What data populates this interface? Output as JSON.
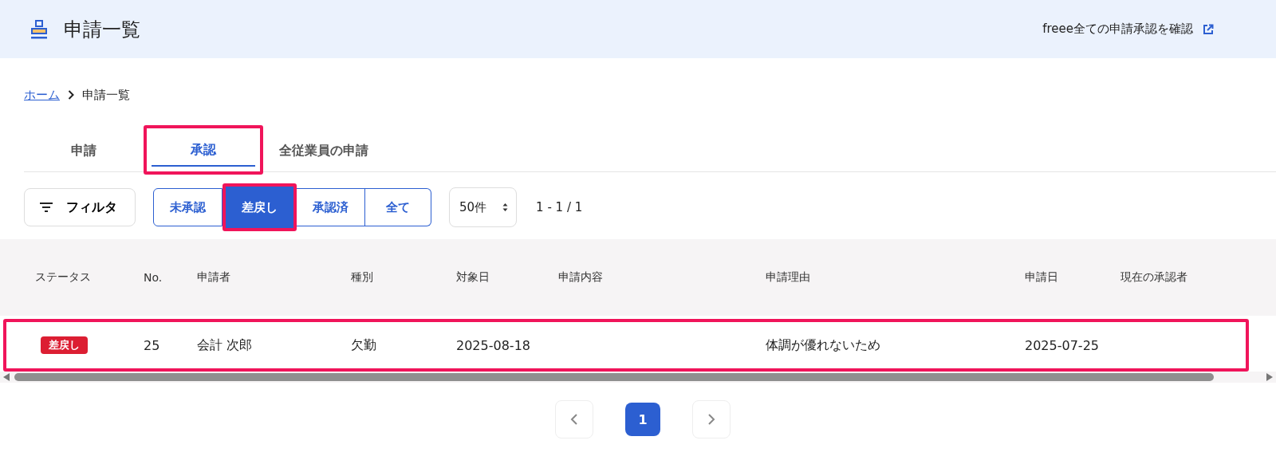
{
  "header": {
    "title": "申請一覧",
    "link": "freee全ての申請承認を確認"
  },
  "breadcrumb": {
    "items": [
      {
        "label": "ホーム",
        "kind": "link"
      },
      {
        "label": "申請一覧",
        "kind": "current"
      }
    ]
  },
  "tabs": [
    {
      "label": "申請",
      "selected": false,
      "highlighted": false
    },
    {
      "label": "承認",
      "selected": true,
      "highlighted": true
    },
    {
      "label": "全従業員の申請",
      "selected": false,
      "highlighted": false
    }
  ],
  "toolbar": {
    "filter": "フィルタ",
    "status_buttons": [
      {
        "label": "未承認",
        "selected": false,
        "highlighted": false
      },
      {
        "label": "差戻し",
        "selected": true,
        "highlighted": true
      },
      {
        "label": "承認済",
        "selected": false,
        "highlighted": false
      },
      {
        "label": "全て",
        "selected": false,
        "highlighted": false
      }
    ],
    "page_size": "50件",
    "range": "1 - 1 / 1"
  },
  "table": {
    "columns": [
      "ステータス",
      "No.",
      "申請者",
      "種別",
      "対象日",
      "申請内容",
      "申請理由",
      "申請日",
      "現在の承認者"
    ],
    "rows": [
      {
        "highlighted": true,
        "cells": [
          "差戻し",
          "25",
          "会計 次郎",
          "欠勤",
          "2025-08-18",
          "",
          "体調が優れないため",
          "2025-07-25",
          ""
        ]
      }
    ]
  },
  "pagination": {
    "pages": [
      {
        "label": "1",
        "selected": true
      }
    ]
  }
}
